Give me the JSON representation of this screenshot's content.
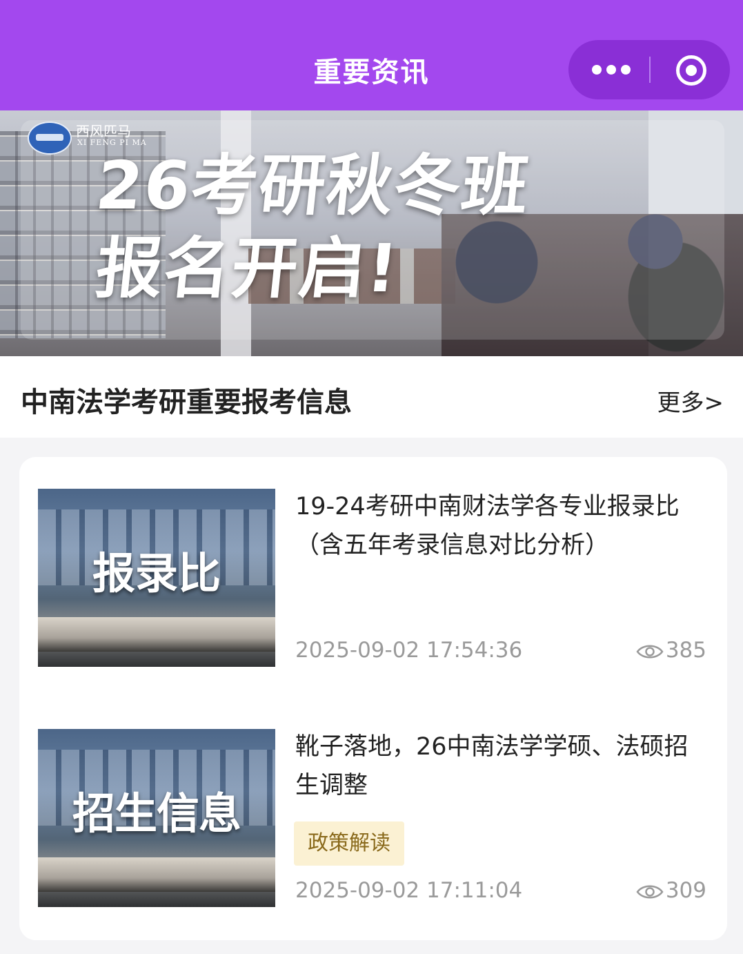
{
  "navbar": {
    "title": "重要资讯",
    "more_icon": "more-dots-icon",
    "close_icon": "target-circle-icon",
    "bg_color": "#a348ee"
  },
  "banner": {
    "logo_cn": "西风匹马",
    "logo_en": "XI FENG PI MA",
    "line1": "26考研秋冬班",
    "line2": "报名开启!"
  },
  "section": {
    "title": "中南法学考研重要报考信息",
    "more": "更多>"
  },
  "articles": [
    {
      "thumb_text": "报录比",
      "title": "19-24考研中南财法学各专业报录比（含五年考录信息对比分析）",
      "date": "2025-09-02 17:54:36",
      "views": "385"
    },
    {
      "thumb_text": "招生信息",
      "title": "靴子落地，26中南法学学硕、法硕招生调整",
      "tag": "政策解读",
      "date": "2025-09-02 17:11:04",
      "views": "309"
    }
  ]
}
